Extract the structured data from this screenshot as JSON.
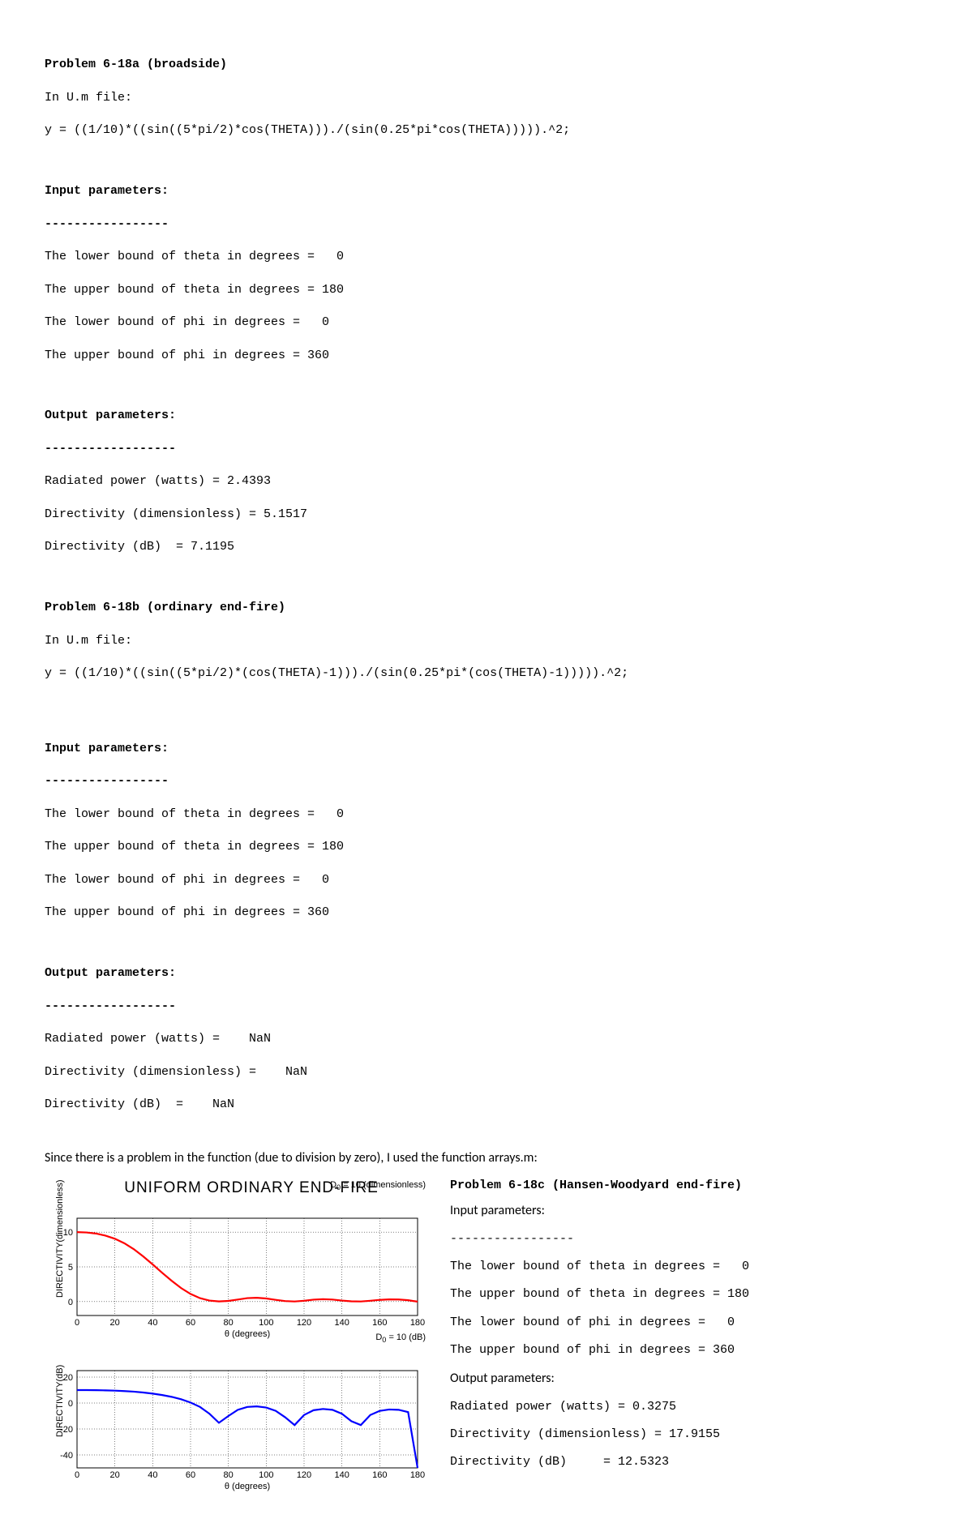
{
  "p18a": {
    "title": "Problem 6-18a (broadside)",
    "file": "In U.m file:",
    "eq": "y = ((1/10)*((sin((5*pi/2)*cos(THETA)))./(sin(0.25*pi*cos(THETA))))).^2;",
    "in_hdr": "Input parameters:",
    "dash1": "-----------------",
    "in1": "The lower bound of theta in degrees =   0",
    "in2": "The upper bound of theta in degrees = 180",
    "in3": "The lower bound of phi in degrees =   0",
    "in4": "The upper bound of phi in degrees = 360",
    "out_hdr": "Output parameters:",
    "dash2": "------------------",
    "out1": "Radiated power (watts) = 2.4393",
    "out2": "Directivity (dimensionless) = 5.1517",
    "out3": "Directivity (dB)  = 7.1195"
  },
  "p18b": {
    "title": "Problem 6-18b (ordinary end-fire)",
    "file": "In U.m file:",
    "eq": "y = ((1/10)*((sin((5*pi/2)*(cos(THETA)-1)))./(sin(0.25*pi*(cos(THETA)-1))))).^2;",
    "in_hdr": "Input parameters:",
    "dash1": "-----------------",
    "in1": "The lower bound of theta in degrees =   0",
    "in2": "The upper bound of theta in degrees = 180",
    "in3": "The lower bound of phi in degrees =   0",
    "in4": "The upper bound of phi in degrees = 360",
    "out_hdr": "Output parameters:",
    "dash2": "------------------",
    "out1": "Radiated power (watts) =    NaN",
    "out2": "Directivity (dimensionless) =    NaN",
    "out3": "Directivity (dB)  =    NaN"
  },
  "note": "Since there is a problem in the function (due to division by zero), I used the function arrays.m:",
  "fig": {
    "title": "UNIFORM ORDINARY END-FIRE",
    "sub1": "D",
    "sub1_idx": "0",
    "sub1_rest": " = 10 (dimensionless)",
    "sub2": "D",
    "sub2_idx": "0",
    "sub2_rest": " = 10 (dB)",
    "xlabel": "θ (degrees)",
    "ylabel1": "DIRECTIVITY(dimensionless)",
    "ylabel2": "DIRECTIVITY(dB)",
    "xticks": [
      "0",
      "20",
      "40",
      "60",
      "80",
      "100",
      "120",
      "140",
      "160",
      "180"
    ],
    "top_yticks": [
      "0",
      "5",
      "10"
    ],
    "bot_yticks": [
      "-40",
      "-20",
      "0",
      "20"
    ]
  },
  "p18c": {
    "title": "Problem 6-18c (Hansen-Woodyard end-fire)",
    "in_hdr": "Input parameters:",
    "dash1": "-----------------",
    "in1": "The lower bound of theta in degrees =   0",
    "in2": "The upper bound of theta in degrees = 180",
    "in3": "The lower bound of phi in degrees =   0",
    "in4": "The upper bound of phi in degrees = 360",
    "out_hdr": "Output parameters:",
    "out1": "Radiated power (watts) = 0.3275",
    "out2": "Directivity (dimensionless) = 17.9155",
    "out3": "Directivity (dB)     = 12.5323"
  },
  "chart_data": [
    {
      "type": "line",
      "title": "UNIFORM ORDINARY END-FIRE",
      "subtitle": "D0 = 10 (dimensionless)",
      "xlabel": "θ (degrees)",
      "ylabel": "DIRECTIVITY(dimensionless)",
      "xlim": [
        0,
        180
      ],
      "ylim": [
        -2,
        12
      ],
      "x": [
        0,
        5,
        10,
        15,
        20,
        25,
        30,
        35,
        40,
        45,
        50,
        55,
        60,
        65,
        70,
        75,
        80,
        85,
        90,
        95,
        100,
        105,
        110,
        115,
        120,
        125,
        130,
        135,
        140,
        145,
        150,
        155,
        160,
        165,
        170,
        175,
        180
      ],
      "values": [
        10,
        9.95,
        9.8,
        9.5,
        9.05,
        8.4,
        7.55,
        6.5,
        5.35,
        4.15,
        3.0,
        1.95,
        1.1,
        0.5,
        0.15,
        0.03,
        0.1,
        0.3,
        0.5,
        0.55,
        0.45,
        0.25,
        0.08,
        0.02,
        0.12,
        0.28,
        0.35,
        0.3,
        0.15,
        0.04,
        0.02,
        0.12,
        0.25,
        0.32,
        0.3,
        0.2,
        0
      ],
      "color": "#ff0000"
    },
    {
      "type": "line",
      "subtitle": "D0 = 10 (dB)",
      "xlabel": "θ (degrees)",
      "ylabel": "DIRECTIVITY(dB)",
      "xlim": [
        0,
        180
      ],
      "ylim": [
        -50,
        25
      ],
      "x": [
        0,
        5,
        10,
        15,
        20,
        25,
        30,
        35,
        40,
        45,
        50,
        55,
        60,
        65,
        70,
        75,
        80,
        85,
        90,
        95,
        100,
        105,
        110,
        115,
        120,
        125,
        130,
        135,
        140,
        145,
        150,
        155,
        160,
        165,
        170,
        175,
        180
      ],
      "values": [
        10,
        9.98,
        9.91,
        9.78,
        9.57,
        9.24,
        8.78,
        8.13,
        7.28,
        6.18,
        4.77,
        2.9,
        0.41,
        -3.01,
        -8.24,
        -15.23,
        -10,
        -5.23,
        -3.01,
        -2.6,
        -3.47,
        -6.02,
        -10.97,
        -16.99,
        -9.21,
        -5.53,
        -4.56,
        -5.23,
        -8.24,
        -13.98,
        -16.99,
        -9.21,
        -6.02,
        -4.95,
        -5.23,
        -6.99,
        -50
      ],
      "color": "#0000ff"
    }
  ]
}
